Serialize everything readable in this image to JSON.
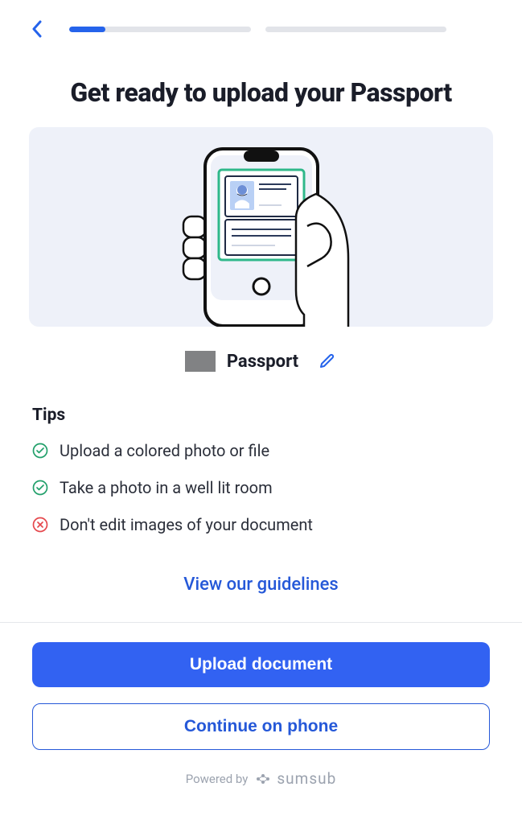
{
  "header": {
    "progress": {
      "step1_percent": 20,
      "step2_percent": 0
    }
  },
  "title": "Get ready to upload your Passport",
  "document": {
    "type": "Passport"
  },
  "tips": {
    "heading": "Tips",
    "items": [
      {
        "ok": true,
        "text": "Upload a colored photo or file"
      },
      {
        "ok": true,
        "text": "Take a photo in a well lit room"
      },
      {
        "ok": false,
        "text": "Don't edit images of your document"
      }
    ]
  },
  "links": {
    "guidelines": "View our guidelines"
  },
  "actions": {
    "primary": "Upload document",
    "secondary": "Continue on phone"
  },
  "footer": {
    "powered_by": "Powered by",
    "brand": "sumsub"
  }
}
